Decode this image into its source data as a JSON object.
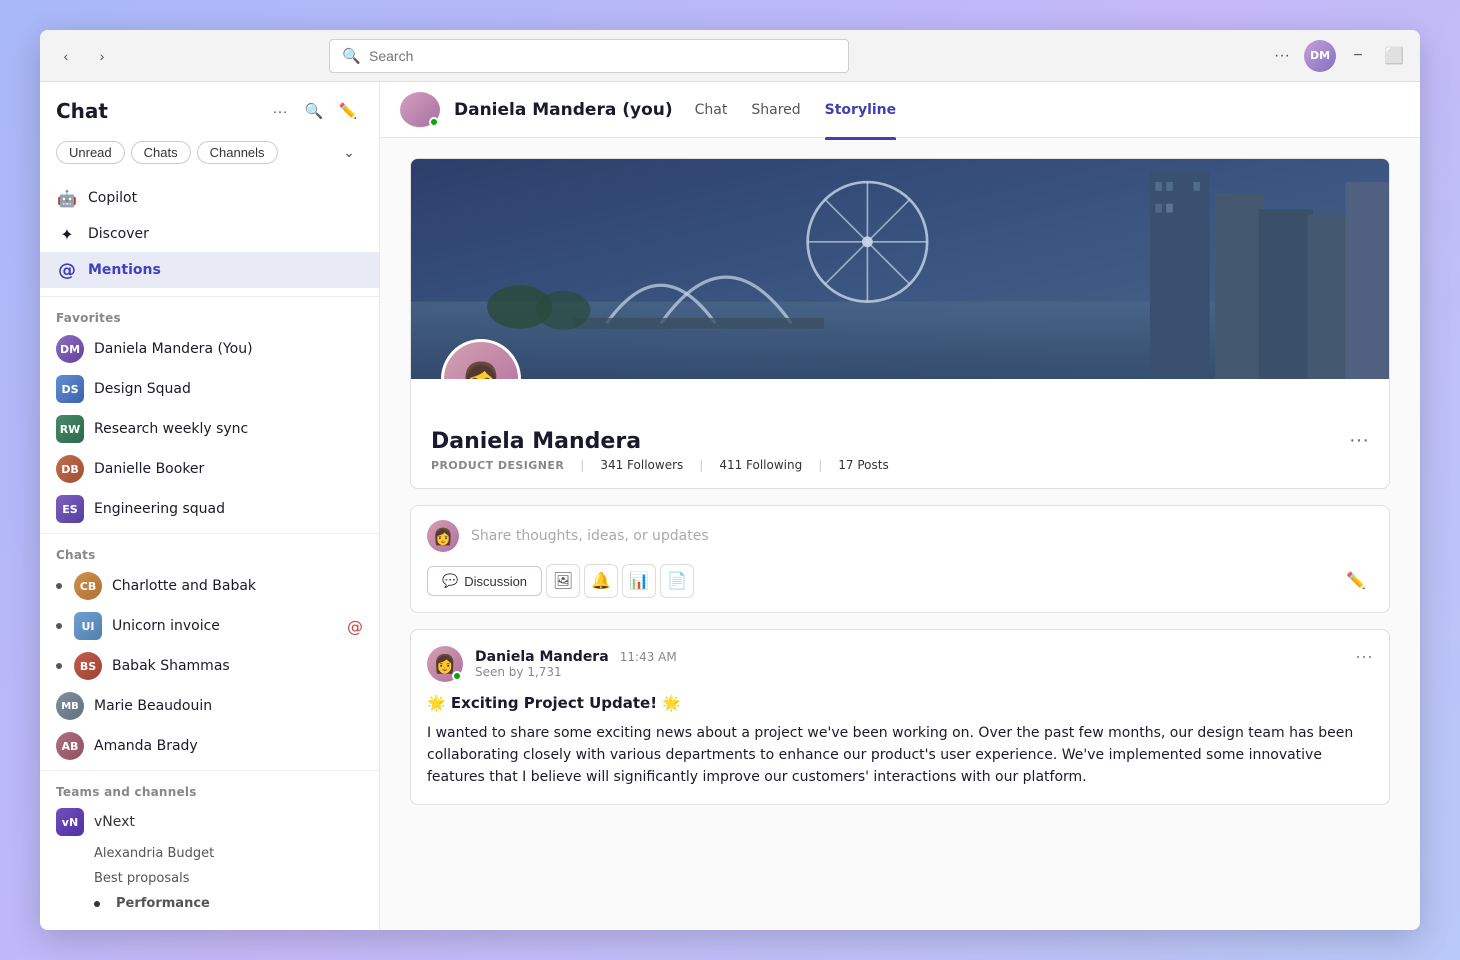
{
  "titlebar": {
    "search_placeholder": "Search",
    "more_label": "···",
    "minimize_label": "−",
    "maximize_label": "⬜"
  },
  "sidebar": {
    "title": "Chat",
    "filter_pills": [
      "Unread",
      "Chats",
      "Channels"
    ],
    "nav_items": [
      {
        "id": "copilot",
        "icon": "🤖",
        "label": "Copilot"
      },
      {
        "id": "discover",
        "icon": "✦",
        "label": "Discover"
      },
      {
        "id": "mentions",
        "icon": "@",
        "label": "Mentions",
        "bold": true
      }
    ],
    "favorites_label": "Favorites",
    "favorites": [
      {
        "id": "daniela-you",
        "label": "Daniela Mandera (You)",
        "color": "#9070c0",
        "initials": "DM"
      },
      {
        "id": "design-squad",
        "label": "Design Squad",
        "color": "#6090d0",
        "initials": "DS",
        "group": true
      },
      {
        "id": "research-weekly",
        "label": "Research weekly sync",
        "color": "#4a8a6a",
        "initials": "RW",
        "group": true
      },
      {
        "id": "danielle-booker",
        "label": "Danielle Booker",
        "color": "#c07050",
        "initials": "DB"
      },
      {
        "id": "engineering-squad",
        "label": "Engineering squad",
        "color": "#7060b0",
        "initials": "ES",
        "group": true
      }
    ],
    "chats_label": "Chats",
    "chats": [
      {
        "id": "charlotte-babak",
        "label": "Charlotte and Babak",
        "color": "#d09050",
        "initials": "CB",
        "bullet": true
      },
      {
        "id": "unicorn-invoice",
        "label": "Unicorn invoice",
        "color": "#70a0d0",
        "initials": "UI",
        "bullet": true,
        "mention": true
      },
      {
        "id": "babak-shammas",
        "label": "Babak Shammas",
        "color": "#c06050",
        "initials": "BS",
        "bullet": true
      },
      {
        "id": "marie-beaudouin",
        "label": "Marie Beaudouin",
        "color": "#8090a0",
        "initials": "MB"
      },
      {
        "id": "amanda-brady",
        "label": "Amanda Brady",
        "color": "#b07080",
        "initials": "AB"
      }
    ],
    "teams_label": "Teams and channels",
    "teams": [
      {
        "id": "vnext",
        "label": "vNext",
        "color": "#7050c0",
        "initials": "vN"
      },
      {
        "id": "alexandria",
        "label": "Alexandria Budget",
        "sub": true
      },
      {
        "id": "best-proposals",
        "label": "Best proposals",
        "sub": true
      },
      {
        "id": "performance",
        "label": "Performance",
        "sub": true,
        "bullet": true,
        "bold": true
      }
    ]
  },
  "header": {
    "user_name": "Daniela Mandera (you)",
    "tabs": [
      "Chat",
      "Shared",
      "Storyline"
    ],
    "active_tab": "Storyline"
  },
  "profile": {
    "name": "Daniela Mandera",
    "role": "PRODUCT DESIGNER",
    "followers": "341 Followers",
    "following": "411 Following",
    "posts": "17 Posts"
  },
  "composer": {
    "placeholder": "Share thoughts, ideas, or updates",
    "discussion_label": "Discussion"
  },
  "post": {
    "author": "Daniela Mandera",
    "time": "11:43 AM",
    "seen": "Seen by 1,731",
    "title": "🌟 Exciting Project Update! 🌟",
    "body": "I wanted to share some exciting news about a project we've been working on. Over the past few months, our design team has been collaborating closely with various departments to enhance our product's user experience. We've implemented some innovative features that I believe will significantly improve our customers' interactions with our platform."
  }
}
